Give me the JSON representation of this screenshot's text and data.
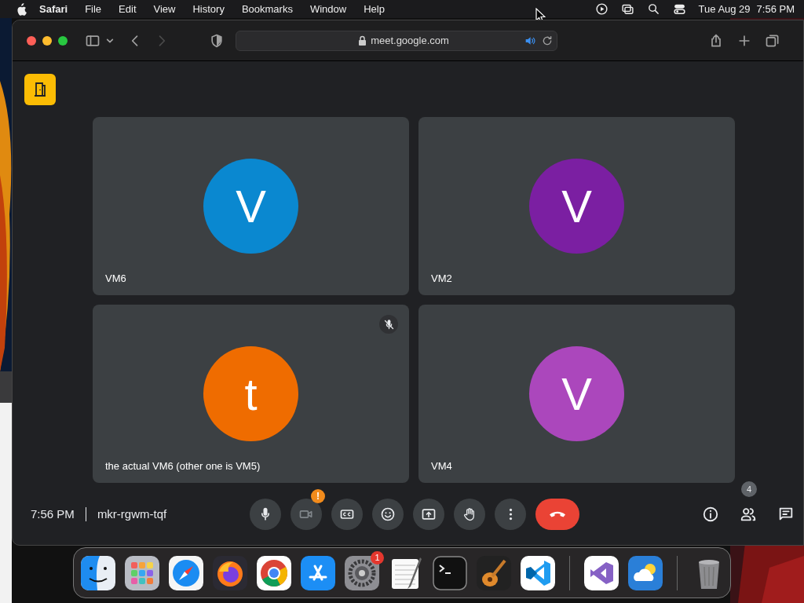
{
  "menubar": {
    "app": "Safari",
    "menus": [
      "File",
      "Edit",
      "View",
      "History",
      "Bookmarks",
      "Window",
      "Help"
    ],
    "date": "Tue Aug 29",
    "time": "7:56 PM"
  },
  "browser": {
    "url": "meet.google.com",
    "forward_disabled": true,
    "audio_playing": true
  },
  "meeting": {
    "tiles": [
      {
        "name": "VM6",
        "initial": "V",
        "color": "#0a88d0",
        "muted": false
      },
      {
        "name": "VM2",
        "initial": "V",
        "color": "#7b1fa2",
        "muted": false
      },
      {
        "name": "the actual VM6 (other one is VM5)",
        "initial": "t",
        "color": "#ef6c00",
        "muted": true
      },
      {
        "name": "VM4",
        "initial": "V",
        "color": "#ab47bc",
        "muted": false
      }
    ],
    "clock": "7:56 PM",
    "meeting_code": "mkr-rgwm-tqf",
    "controls": [
      {
        "kind": "mic"
      },
      {
        "kind": "camera",
        "badge": "!"
      },
      {
        "kind": "captions"
      },
      {
        "kind": "emoji"
      },
      {
        "kind": "present"
      },
      {
        "kind": "hand"
      },
      {
        "kind": "more"
      },
      {
        "kind": "end"
      }
    ],
    "side_controls": [
      {
        "kind": "info"
      },
      {
        "kind": "people",
        "badge": "4"
      },
      {
        "kind": "chat"
      }
    ]
  },
  "dock": {
    "apps": [
      {
        "kind": "finder"
      },
      {
        "kind": "launchpad"
      },
      {
        "kind": "safari"
      },
      {
        "kind": "firefox"
      },
      {
        "kind": "chrome"
      },
      {
        "kind": "appstore"
      },
      {
        "kind": "settings",
        "badge": "1"
      },
      {
        "kind": "textedit"
      },
      {
        "kind": "terminal"
      },
      {
        "kind": "garageband"
      },
      {
        "kind": "vscode"
      },
      {
        "kind": "separator"
      },
      {
        "kind": "visualstudio"
      },
      {
        "kind": "weather"
      },
      {
        "kind": "separator"
      },
      {
        "kind": "trash"
      }
    ]
  }
}
